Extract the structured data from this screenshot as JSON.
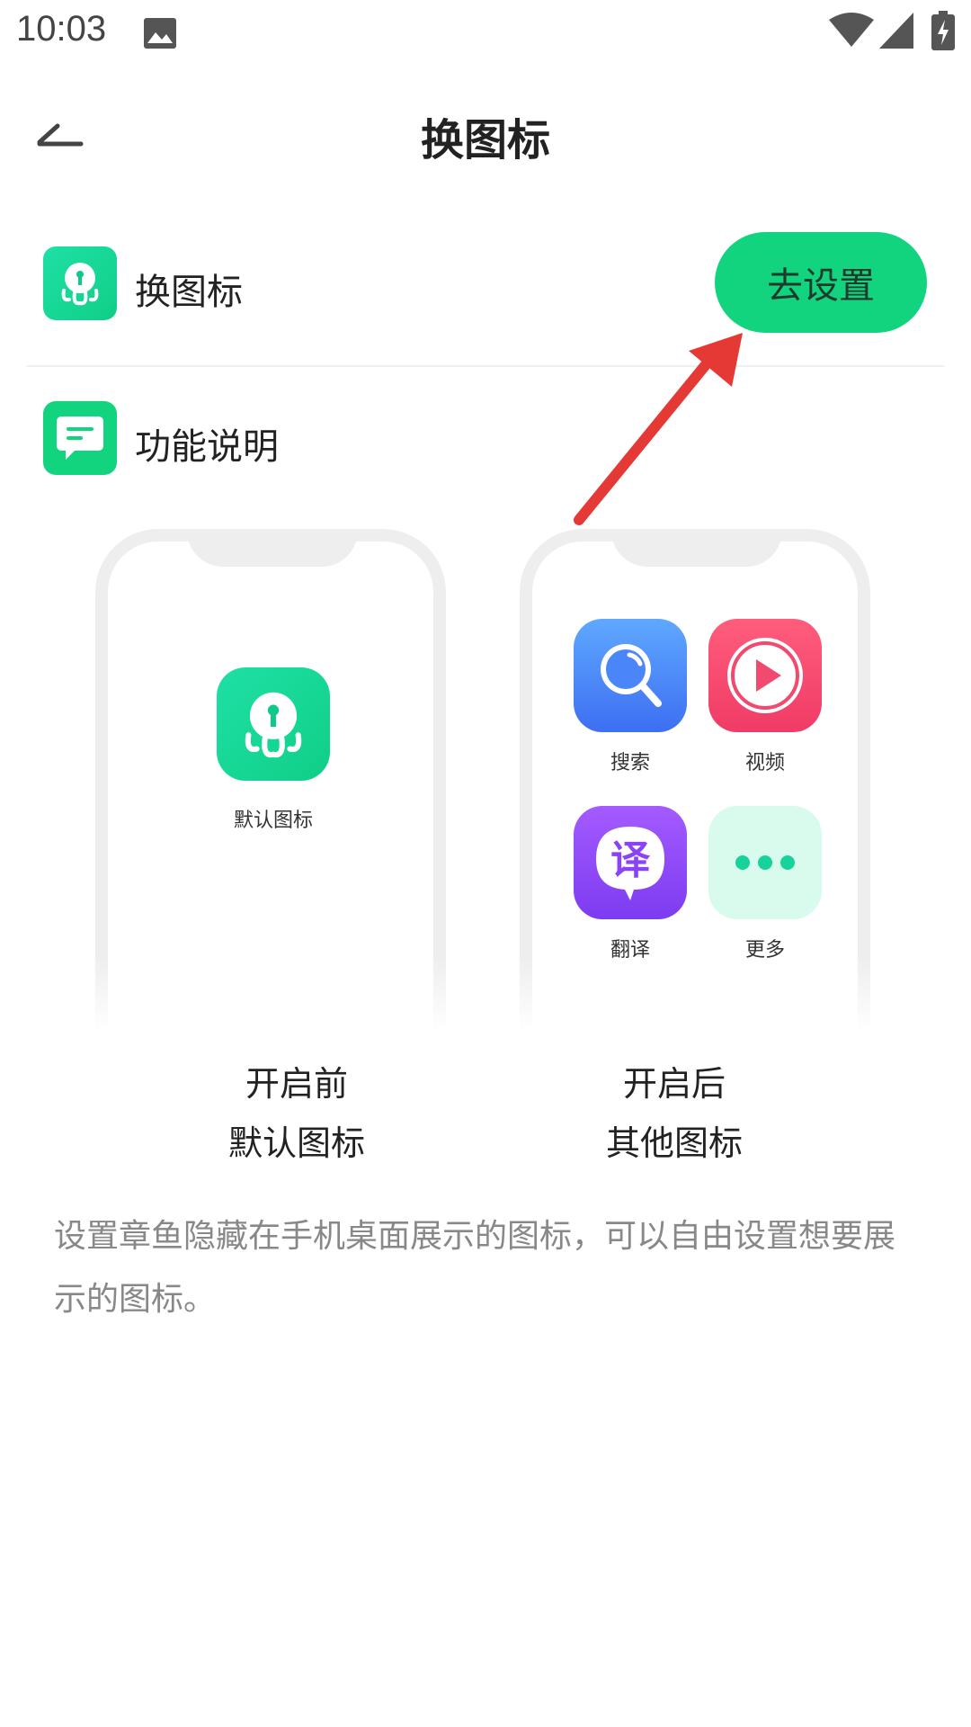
{
  "status_bar": {
    "time": "10:03"
  },
  "header": {
    "title": "换图标"
  },
  "rows": {
    "change_icon_label": "换图标",
    "go_settings_label": "去设置",
    "feature_label": "功能说明"
  },
  "before_phone": {
    "app_label": "默认图标"
  },
  "after_phone": {
    "apps": [
      "搜索",
      "视频",
      "翻译",
      "更多"
    ],
    "translate_glyph": "译"
  },
  "captions": {
    "before_line1": "开启前",
    "before_line2": "默认图标",
    "after_line1": "开启后",
    "after_line2": "其他图标"
  },
  "description": "设置章鱼隐藏在手机桌面展示的图标，可以自由设置想要展示的图标。",
  "colors": {
    "accent_green": "#12d47e",
    "arrow_red": "#e53935"
  }
}
